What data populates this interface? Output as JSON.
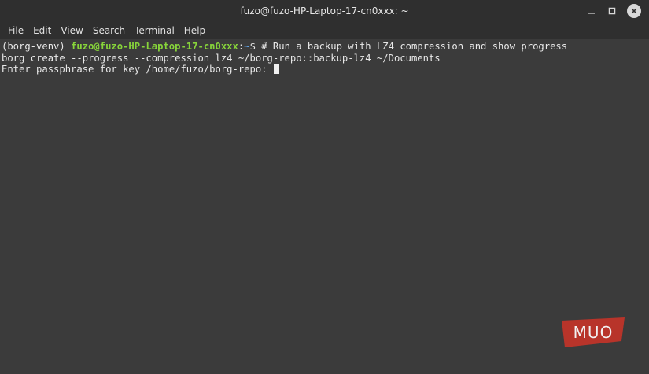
{
  "window": {
    "title": "fuzo@fuzo-HP-Laptop-17-cn0xxx: ~"
  },
  "menu": {
    "items": [
      "File",
      "Edit",
      "View",
      "Search",
      "Terminal",
      "Help"
    ]
  },
  "terminal": {
    "line1": {
      "env": "(borg-venv) ",
      "user_host": "fuzo@fuzo-HP-Laptop-17-cn0xxx",
      "sep": ":",
      "path": "~",
      "command": "$ # Run a backup with LZ4 compression and show progress"
    },
    "line2": "borg create --progress --compression lz4 ~/borg-repo::backup-lz4 ~/Documents",
    "line3": "Enter passphrase for key /home/fuzo/borg-repo: "
  },
  "watermark": {
    "text": "MUO",
    "color": "#b8342a"
  },
  "colors": {
    "background": "#3b3b3b",
    "titlebar": "#2f2f2f",
    "prompt_user": "#87d43a",
    "prompt_path": "#5ea1e6"
  }
}
